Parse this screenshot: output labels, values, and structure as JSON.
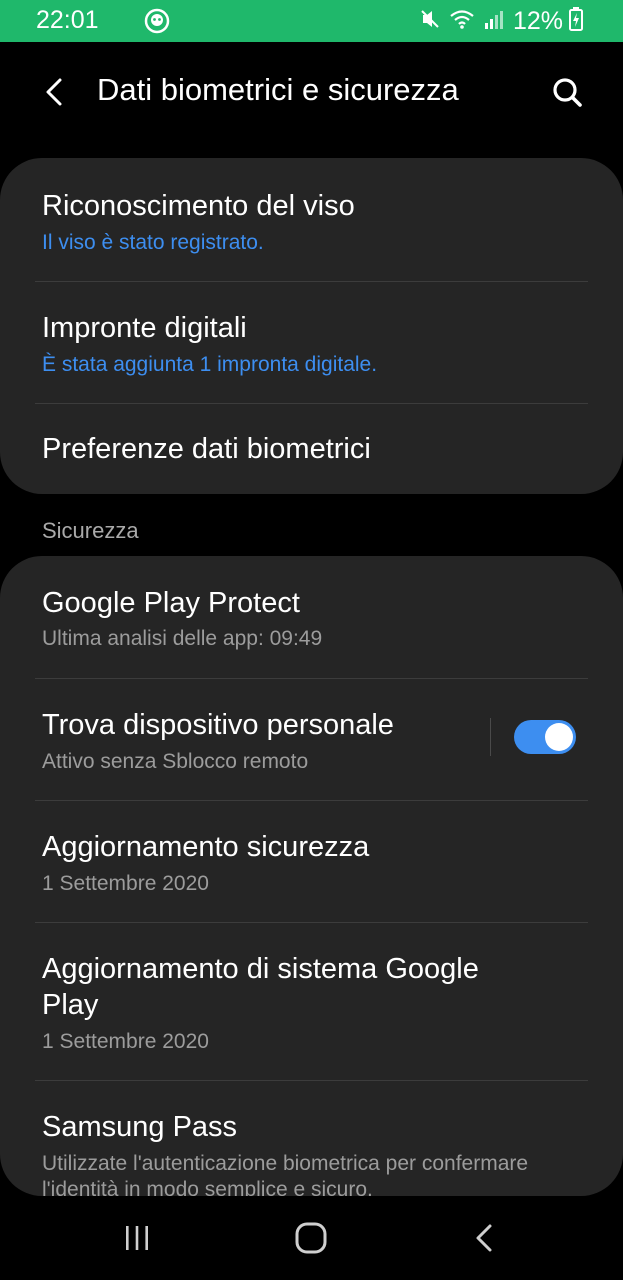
{
  "status_bar": {
    "time": "22:01",
    "battery": "12%",
    "background_color": "#1fb86b",
    "icons": [
      "app-notification-icon",
      "mute-icon",
      "wifi-icon",
      "signal-icon",
      "battery-charging-icon"
    ]
  },
  "header": {
    "title": "Dati biometrici e sicurezza",
    "icons": [
      "back-arrow-icon",
      "search-icon"
    ]
  },
  "biometrics": {
    "items": [
      {
        "title": "Riconoscimento del viso",
        "subtitle": "Il viso è stato registrato."
      },
      {
        "title": "Impronte digitali",
        "subtitle": "È stata aggiunta 1 impronta digitale."
      },
      {
        "title": "Preferenze dati biometrici"
      }
    ]
  },
  "security": {
    "section_label": "Sicurezza",
    "items": [
      {
        "title": "Google Play Protect",
        "subtitle": "Ultima analisi delle app: 09:49"
      },
      {
        "title": "Trova dispositivo personale",
        "subtitle": "Attivo senza Sblocco remoto",
        "toggle_on": true
      },
      {
        "title": "Aggiornamento sicurezza",
        "subtitle": "1 Settembre 2020"
      },
      {
        "title": "Aggiornamento di sistema Google Play",
        "subtitle": "1 Settembre 2020"
      },
      {
        "title": "Samsung Pass",
        "subtitle": "Utilizzate l'autenticazione biometrica per confermare l'identità in modo semplice e sicuro."
      }
    ]
  },
  "nav_bar": {
    "icons": [
      "recent-apps-icon",
      "home-icon",
      "back-icon"
    ]
  },
  "colors": {
    "accent": "#3d8ef0",
    "card": "#252525",
    "background": "#000000"
  }
}
